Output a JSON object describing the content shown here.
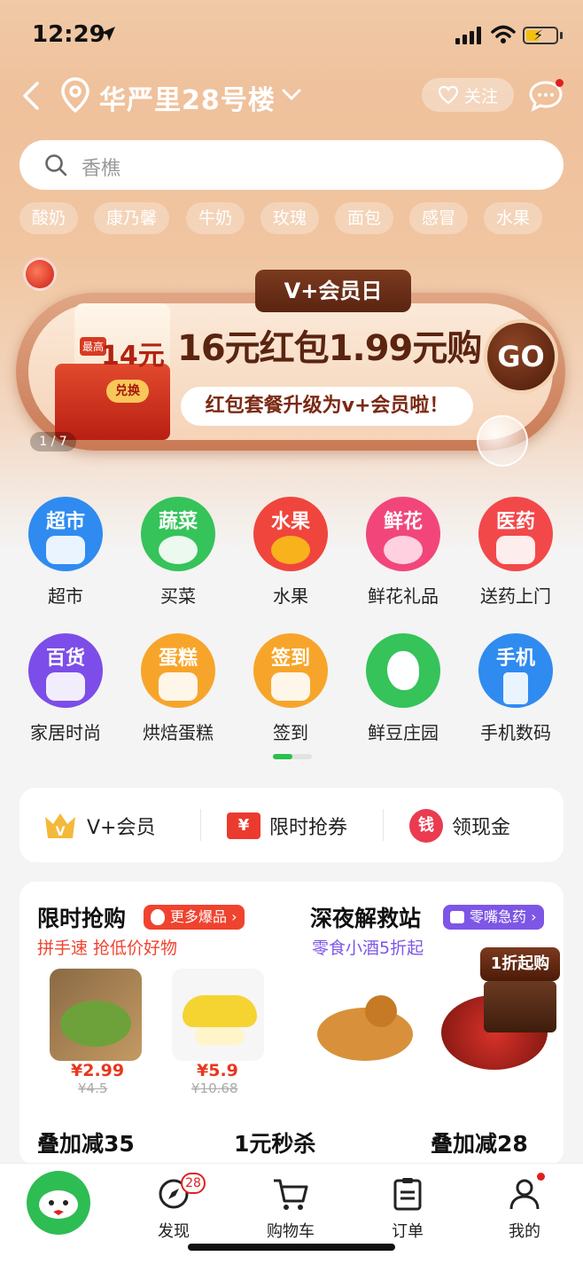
{
  "status_bar": {
    "time": "12:29"
  },
  "header": {
    "address": "华严里28号楼",
    "follow_label": "关注"
  },
  "search": {
    "placeholder": "香樵"
  },
  "chips": [
    "酸奶",
    "康乃馨",
    "牛奶",
    "玫瑰",
    "面包",
    "感冒",
    "水果"
  ],
  "banner": {
    "tag": "V+会员日",
    "card_badge": "最高",
    "amount": "14元",
    "exchange": "兑换",
    "title": "16元红包1.99元购",
    "subtitle": "红包套餐升级为v+会员啦！",
    "go": "GO",
    "pager": "1 / 7"
  },
  "categories": [
    {
      "icon_text": "超市",
      "label": "超市",
      "color": "#2f8bf0"
    },
    {
      "icon_text": "蔬菜",
      "label": "买菜",
      "color": "#35c35a"
    },
    {
      "icon_text": "水果",
      "label": "水果",
      "color": "#f0453c"
    },
    {
      "icon_text": "鲜花",
      "label": "鲜花礼品",
      "color": "#f2467b"
    },
    {
      "icon_text": "医药",
      "label": "送药上门",
      "color": "#f2484a"
    },
    {
      "icon_text": "百货",
      "label": "家居时尚",
      "color": "#7c4de8"
    },
    {
      "icon_text": "蛋糕",
      "label": "烘焙蛋糕",
      "color": "#f7a52a"
    },
    {
      "icon_text": "签到",
      "label": "签到",
      "color": "#f7a52a"
    },
    {
      "icon_text": "",
      "label": "鲜豆庄园",
      "color": "#35c35a"
    },
    {
      "icon_text": "手机",
      "label": "手机数码",
      "color": "#2f8bf0"
    }
  ],
  "vip_strip": {
    "vip": "V+会员",
    "coupon": "限时抢券",
    "coupon_icon": "¥",
    "cash": "领现金",
    "cash_icon": "钱"
  },
  "flash_sale": {
    "title": "限时抢购",
    "tag": "更多爆品",
    "subtitle": "拼手速 抢低价好物",
    "products": [
      {
        "price": "¥2.99",
        "original": "¥4.5"
      },
      {
        "price": "¥5.9",
        "original": "¥10.68"
      }
    ]
  },
  "night_station": {
    "title": "深夜解救站",
    "tag": "零嘴急药",
    "subtitle": "零食小酒5折起",
    "promo": "1折起购"
  },
  "bottom_titles": [
    "叠加减35",
    "1元秒杀",
    "叠加减28"
  ],
  "tabbar": {
    "discover": "发现",
    "discover_badge": "28",
    "cart": "购物车",
    "orders": "订单",
    "me": "我的"
  },
  "colors": {
    "accent_green": "#2ebd53",
    "price_red": "#e8371f",
    "subtitle_red": "#f0432f",
    "subtitle_purple": "#7d56e6"
  }
}
